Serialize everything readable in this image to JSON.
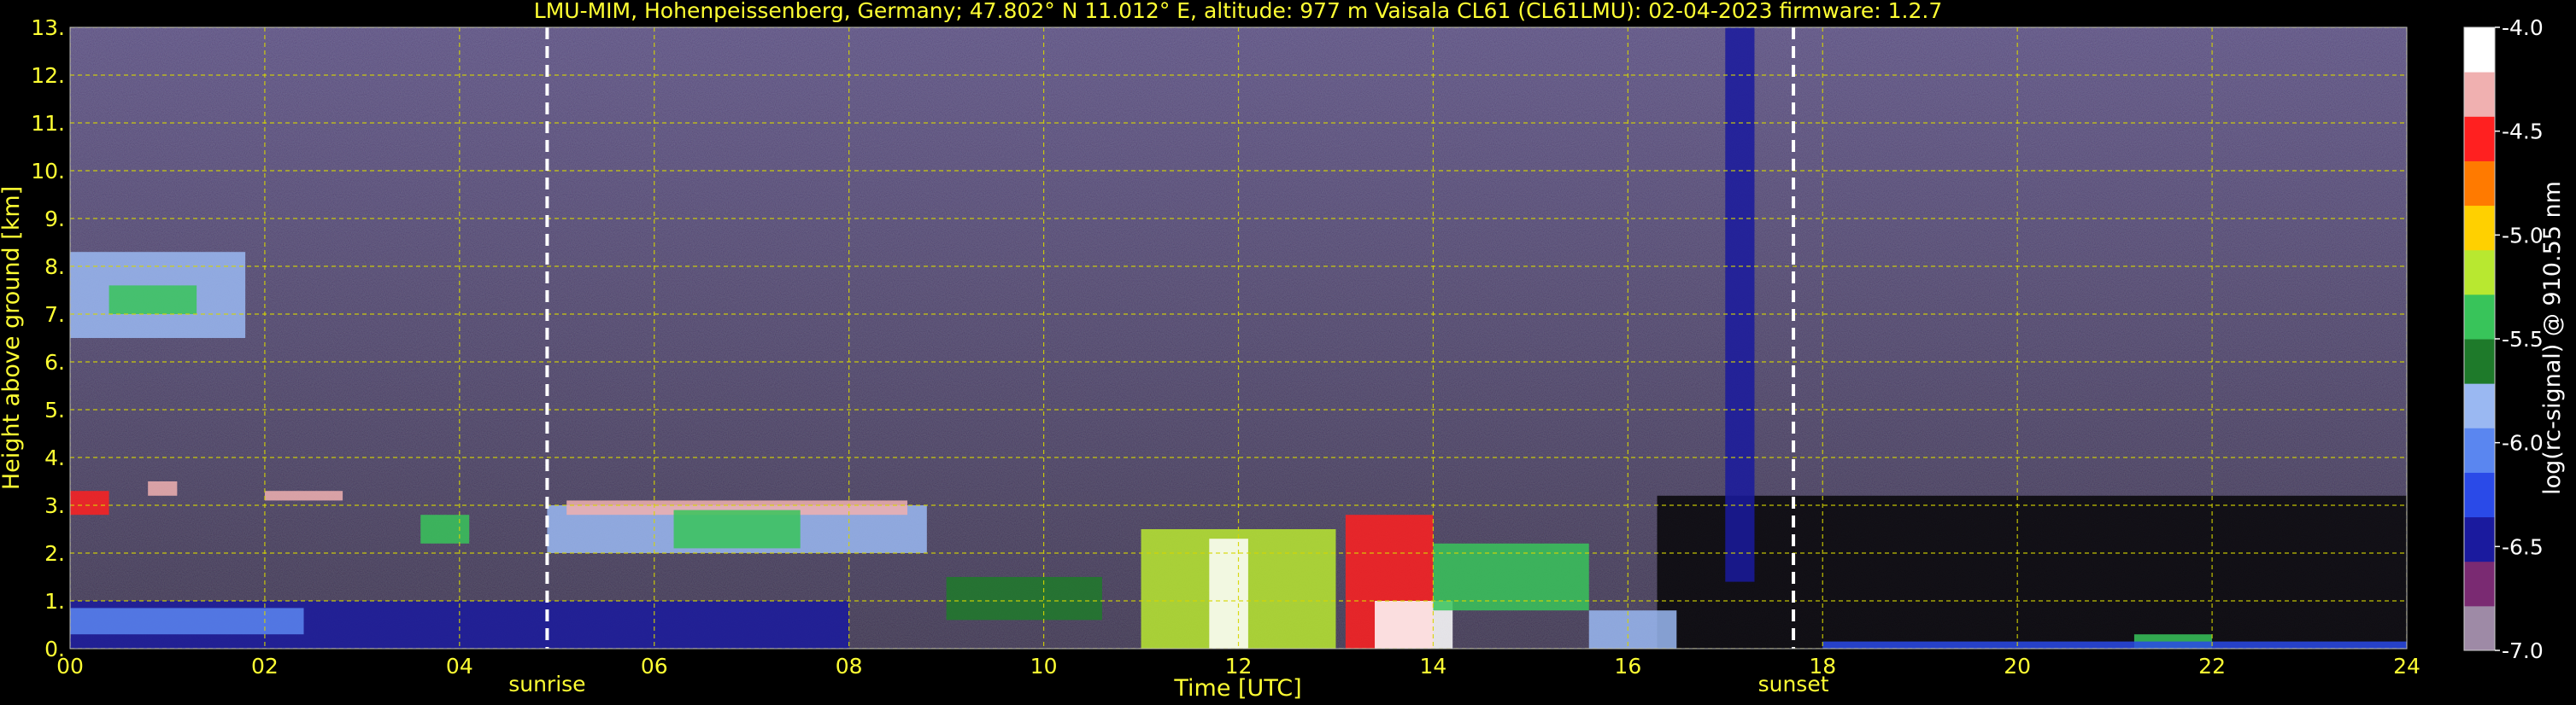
{
  "chart_data": {
    "type": "heatmap",
    "title": "LMU-MIM, Hohenpeissenberg, Germany; 47.802° N 11.012° E, altitude: 977 m    Vaisala CL61 (CL61LMU): 02-04-2023    firmware: 1.2.7",
    "xlabel": "Time [UTC]",
    "ylabel": "Height above ground [km]",
    "xlim": [
      0,
      24
    ],
    "ylim": [
      0,
      13
    ],
    "x_ticks": [
      "00",
      "02",
      "04",
      "06",
      "08",
      "10",
      "12",
      "14",
      "16",
      "18",
      "20",
      "22",
      "24"
    ],
    "y_ticks": [
      "0.",
      "1.",
      "2.",
      "3.",
      "4.",
      "5.",
      "6.",
      "7.",
      "8.",
      "9.",
      "10.",
      "11.",
      "12.",
      "13."
    ],
    "grid": true,
    "markers": [
      {
        "label": "sunrise",
        "x": 4.9
      },
      {
        "label": "sunset",
        "x": 17.7
      }
    ],
    "colorbar": {
      "label": "log(rc-signal) @ 910.55 nm",
      "range": [
        -7.0,
        -4.0
      ],
      "ticks": [
        "-4.0",
        "-4.5",
        "-5.0",
        "-5.5",
        "-6.0",
        "-6.5",
        "-7.0"
      ]
    },
    "layers": [
      {
        "x_start": 0,
        "x_end": 8.0,
        "y_bottom": 0,
        "y_top": 1.0,
        "level": -6.4
      },
      {
        "x_start": 0,
        "x_end": 2.4,
        "y_bottom": 0.3,
        "y_top": 0.85,
        "level": -6.0
      },
      {
        "x_start": 0,
        "x_end": 0.4,
        "y_bottom": 2.8,
        "y_top": 3.3,
        "level": -4.6
      },
      {
        "x_start": 0.8,
        "x_end": 1.1,
        "y_bottom": 3.2,
        "y_top": 3.5,
        "level": -4.3
      },
      {
        "x_start": 0,
        "x_end": 1.8,
        "y_bottom": 6.5,
        "y_top": 8.3,
        "level": -5.9
      },
      {
        "x_start": 0.4,
        "x_end": 1.3,
        "y_bottom": 7.0,
        "y_top": 7.6,
        "level": -5.3
      },
      {
        "x_start": 2.0,
        "x_end": 2.8,
        "y_bottom": 3.1,
        "y_top": 3.3,
        "level": -4.4
      },
      {
        "x_start": 3.6,
        "x_end": 4.1,
        "y_bottom": 2.2,
        "y_top": 2.8,
        "level": -5.5
      },
      {
        "x_start": 4.9,
        "x_end": 8.8,
        "y_bottom": 2.0,
        "y_top": 3.0,
        "level": -5.8
      },
      {
        "x_start": 5.1,
        "x_end": 8.6,
        "y_bottom": 2.8,
        "y_top": 3.1,
        "level": -4.3
      },
      {
        "x_start": 6.2,
        "x_end": 7.5,
        "y_bottom": 2.1,
        "y_top": 2.9,
        "level": -5.4
      },
      {
        "x_start": 9.0,
        "x_end": 10.6,
        "y_bottom": 0.6,
        "y_top": 1.5,
        "level": -5.7
      },
      {
        "x_start": 11.0,
        "x_end": 13.0,
        "y_bottom": 0,
        "y_top": 2.5,
        "level": -5.2
      },
      {
        "x_start": 11.7,
        "x_end": 12.1,
        "y_bottom": 0,
        "y_top": 2.3,
        "level": -4.2
      },
      {
        "x_start": 13.1,
        "x_end": 14.0,
        "y_bottom": 0,
        "y_top": 2.8,
        "level": -4.6
      },
      {
        "x_start": 13.4,
        "x_end": 14.2,
        "y_bottom": 0,
        "y_top": 1.0,
        "level": -4.2
      },
      {
        "x_start": 14.0,
        "x_end": 15.6,
        "y_bottom": 0.8,
        "y_top": 2.2,
        "level": -5.3
      },
      {
        "x_start": 15.6,
        "x_end": 16.5,
        "y_bottom": 0,
        "y_top": 0.8,
        "level": -5.8
      },
      {
        "x_start": 17.0,
        "x_end": 17.3,
        "y_bottom": 1.4,
        "y_top": 13.0,
        "level": -6.5
      },
      {
        "x_start": 21.2,
        "x_end": 22.0,
        "y_bottom": 0,
        "y_top": 0.3,
        "level": -5.5
      },
      {
        "x_start": 18.0,
        "x_end": 24.0,
        "y_bottom": 0,
        "y_top": 0.15,
        "level": -6.2
      }
    ]
  }
}
